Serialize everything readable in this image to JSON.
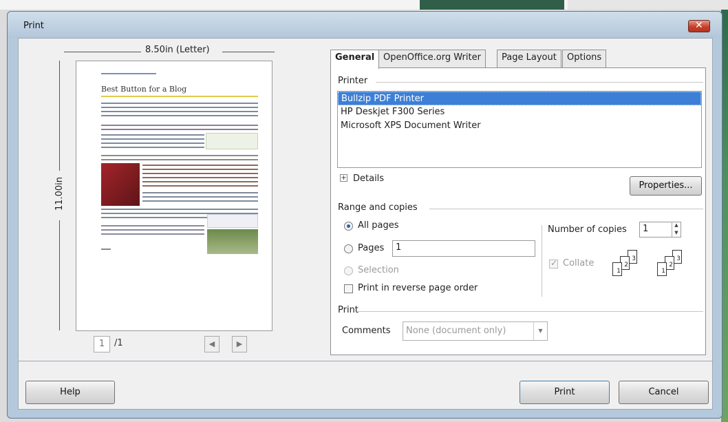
{
  "window": {
    "title": "Print"
  },
  "preview": {
    "width_label": "8.50in (Letter)",
    "height_label": "11.00in",
    "page_title": "Best Button for a Blog",
    "current_page": "1",
    "total_pages": "/1"
  },
  "tabs": [
    {
      "label": "General",
      "active": true
    },
    {
      "label": "OpenOffice.org Writer",
      "active": false
    },
    {
      "label": "Page Layout",
      "active": false
    },
    {
      "label": "Options",
      "active": false
    }
  ],
  "printer": {
    "section_label": "Printer",
    "list": [
      "Bullzip PDF Printer",
      "HP Deskjet F300 Series",
      "Microsoft XPS Document Writer"
    ],
    "selected_index": 0,
    "details_label": "Details",
    "properties_label": "Properties..."
  },
  "range": {
    "section_label": "Range and copies",
    "all_pages_label": "All pages",
    "pages_label": "Pages",
    "pages_value": "1",
    "selection_label": "Selection",
    "reverse_label": "Print in reverse page order",
    "copies_label": "Number of copies",
    "copies_value": "1",
    "collate_label": "Collate"
  },
  "print_section": {
    "section_label": "Print",
    "comments_label": "Comments",
    "comments_value": "None (document only)"
  },
  "buttons": {
    "help": "Help",
    "print": "Print",
    "cancel": "Cancel"
  },
  "colors": {
    "selection": "#3d7fd6",
    "titlebar": "#b5c9dc",
    "close": "#c8402b"
  }
}
